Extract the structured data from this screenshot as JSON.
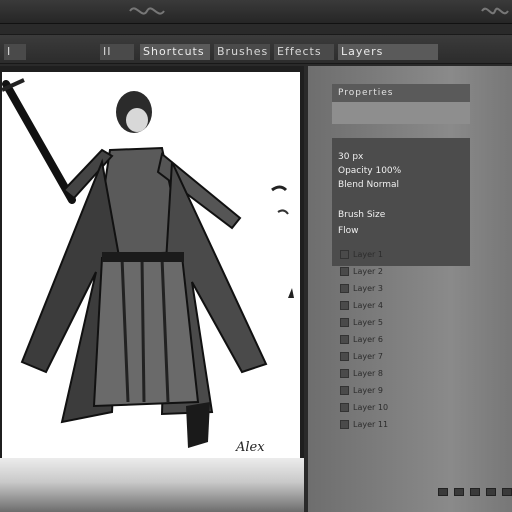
{
  "toolbar": {
    "items": [
      {
        "label": "I"
      },
      {
        "label": "II"
      },
      {
        "label": "Shortcuts"
      },
      {
        "label": "Brushes"
      },
      {
        "label": "Effects"
      },
      {
        "label": "Layers"
      }
    ]
  },
  "canvas": {
    "signature": "Alex"
  },
  "panel": {
    "header": "Properties",
    "rows": [
      {
        "label": "30 px"
      },
      {
        "label": "Opacity 100%"
      },
      {
        "label": "Blend Normal"
      },
      {
        "label": "Brush Size"
      },
      {
        "label": "Flow"
      }
    ],
    "layers": [
      {
        "name": "Layer 1"
      },
      {
        "name": "Layer 2"
      },
      {
        "name": "Layer 3"
      },
      {
        "name": "Layer 4"
      },
      {
        "name": "Layer 5"
      },
      {
        "name": "Layer 6"
      },
      {
        "name": "Layer 7"
      },
      {
        "name": "Layer 8"
      },
      {
        "name": "Layer 9"
      },
      {
        "name": "Layer 10"
      },
      {
        "name": "Layer 11"
      }
    ]
  },
  "colors": {
    "accent": "#4a4a4a",
    "canvas_bg": "#ffffff"
  },
  "icons": {
    "ornament": "ornament-icon",
    "figure": "character-sketch"
  }
}
